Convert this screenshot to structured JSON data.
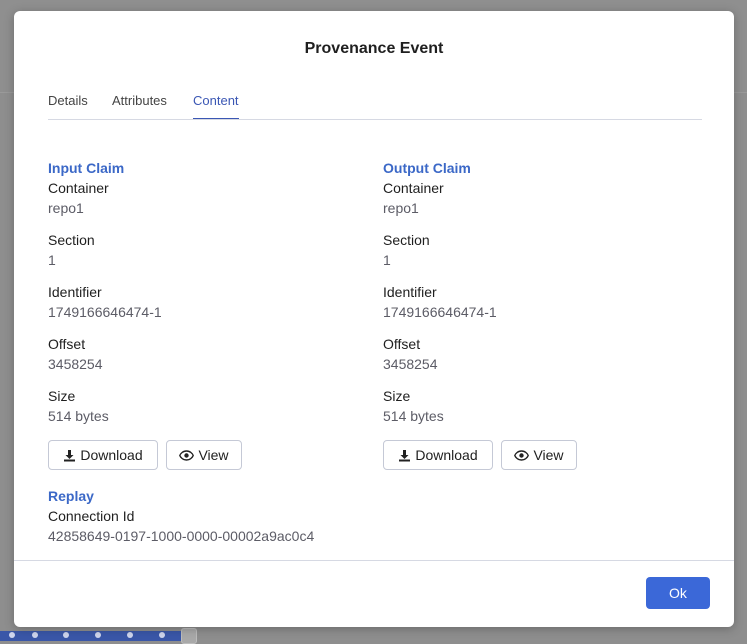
{
  "dialog": {
    "title": "Provenance Event"
  },
  "tabs": [
    {
      "label": "Details"
    },
    {
      "label": "Attributes"
    },
    {
      "label": "Content"
    }
  ],
  "input_claim": {
    "title": "Input Claim",
    "fields": [
      {
        "label": "Container",
        "value": "repo1"
      },
      {
        "label": "Section",
        "value": "1"
      },
      {
        "label": "Identifier",
        "value": "1749166646474-1"
      },
      {
        "label": "Offset",
        "value": "3458254"
      },
      {
        "label": "Size",
        "value": "514 bytes"
      }
    ],
    "download_label": "Download",
    "view_label": "View"
  },
  "output_claim": {
    "title": "Output Claim",
    "fields": [
      {
        "label": "Container",
        "value": "repo1"
      },
      {
        "label": "Section",
        "value": "1"
      },
      {
        "label": "Identifier",
        "value": "1749166646474-1"
      },
      {
        "label": "Offset",
        "value": "3458254"
      },
      {
        "label": "Size",
        "value": "514 bytes"
      }
    ],
    "download_label": "Download",
    "view_label": "View"
  },
  "replay": {
    "title": "Replay",
    "connection_label": "Connection Id",
    "connection_value": "42858649-0197-1000-0000-00002a9ac0c4"
  },
  "footer": {
    "ok_label": "Ok"
  },
  "icons": {
    "download": "download-icon",
    "view": "eye-icon"
  },
  "colors": {
    "accent": "#3b68d8",
    "link": "#3b68c7"
  }
}
